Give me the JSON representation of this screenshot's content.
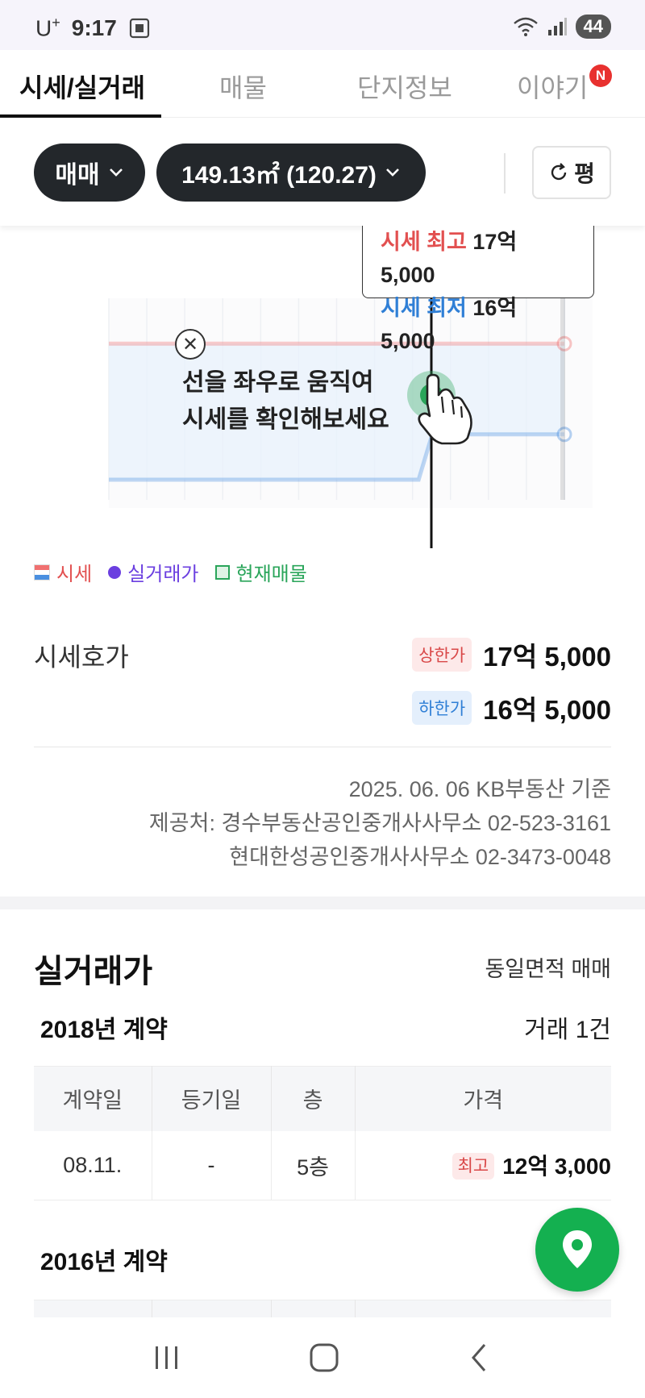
{
  "status": {
    "carrier": "U",
    "carrier_plus": "+",
    "time": "9:17",
    "battery": "44"
  },
  "tabs": [
    {
      "label": "시세/실거래",
      "active": true
    },
    {
      "label": "매물",
      "active": false
    },
    {
      "label": "단지정보",
      "active": false
    },
    {
      "label": "이야기",
      "active": false,
      "badge": "N"
    }
  ],
  "filters": {
    "trade_type": "매매",
    "area": "149.13㎡ (120.27)",
    "unit_toggle": "평"
  },
  "tooltip": {
    "high_label": "시세 최고",
    "high_value": "17억 5,000",
    "low_label": "시세 최저",
    "low_value": "16억 5,000"
  },
  "guide": {
    "line1": "선을 좌우로 움직여",
    "line2": "시세를 확인해보세요"
  },
  "chart_data": {
    "type": "line",
    "series": [
      {
        "x": [
          0,
          0.78,
          0.8,
          1
        ],
        "y": [
          17.5,
          17.5,
          17.5,
          17.5
        ]
      },
      {
        "x": [
          0,
          0.68,
          0.71,
          1
        ],
        "y": [
          16.0,
          16.0,
          16.5,
          16.5
        ]
      }
    ],
    "ylim": [
      16.0,
      18.0
    ],
    "colors": {
      "upper": "#f07070",
      "lower": "#4a8fe0",
      "band": "#e8f1fc",
      "selector": "#2aa55a"
    }
  },
  "legend": {
    "sise": "시세",
    "deal": "실거래가",
    "listing": "현재매물"
  },
  "asking": {
    "label": "시세호가",
    "upper_badge": "상한가",
    "upper_value": "17억 5,000",
    "lower_badge": "하한가",
    "lower_value": "16억 5,000"
  },
  "source": {
    "line1": "2025. 06. 06 KB부동산 기준",
    "line2": "제공처: 경수부동산공인중개사사무소 02-523-3161",
    "line3": "현대한성공인중개사사무소 02-3473-0048"
  },
  "deals": {
    "title": "실거래가",
    "filter": "동일면적 매매",
    "year_2018": "2018년 계약",
    "count_2018": "거래 1건",
    "columns": [
      "계약일",
      "등기일",
      "층",
      "가격"
    ],
    "rows": [
      {
        "date": "08.11.",
        "registered": "-",
        "floor": "5층",
        "badge": "최고",
        "price": "12억 3,000"
      }
    ],
    "year_2016": "2016년 계약"
  },
  "icons": {
    "signal": "wifi-icon",
    "map_fab": "map-pin-icon"
  }
}
